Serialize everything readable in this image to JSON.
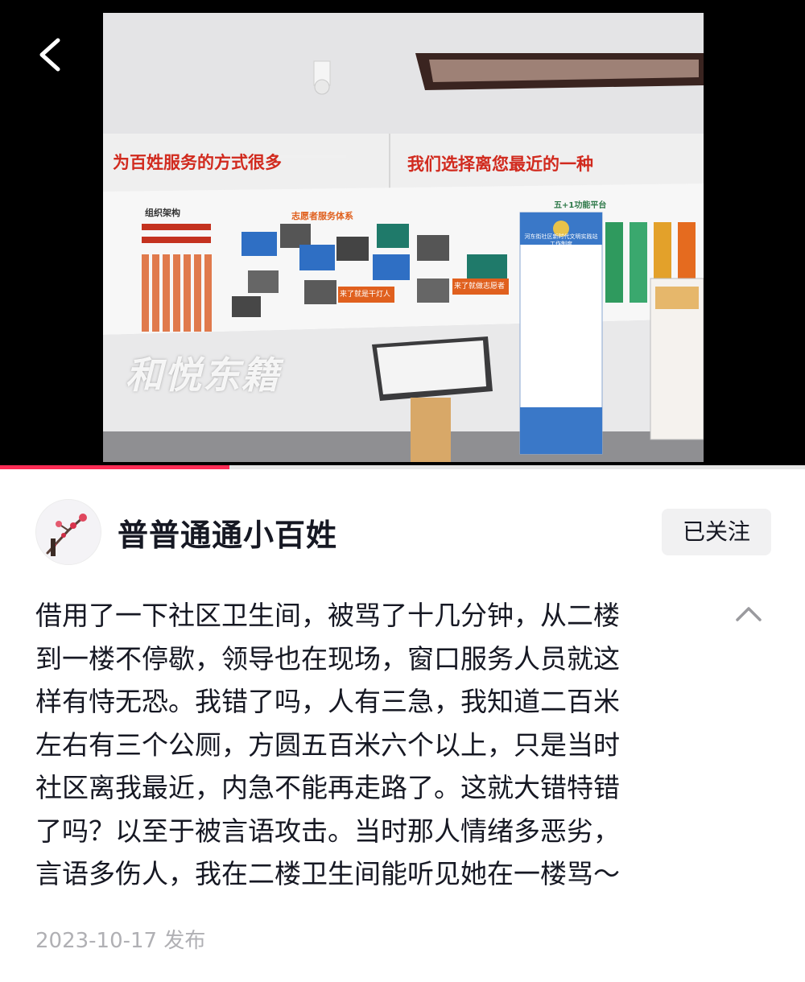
{
  "photo": {
    "banner_left": "为百姓服务的方式很多",
    "banner_right": "我们选择离您最近的一种",
    "org_title": "组织架构",
    "service_title": "志愿者服务体系",
    "platform_title": "五+1功能平台",
    "slogan_1": "来了就是干灯人",
    "slogan_2": "来了就做志愿者",
    "standee_title": "河东街社区新时代文明实践站工作制度",
    "watermark": "和悦东籍"
  },
  "progress": {
    "fraction": 0.285,
    "color": "#fe2c55"
  },
  "author": {
    "name": "普普通通小百姓",
    "avatar_icon": "plum-blossom-icon"
  },
  "follow": {
    "label": "已关注"
  },
  "post": {
    "lines": [
      "借用了一下社区卫生间，被骂了十几分钟，从二楼",
      "到一楼不停歇，领导也在现场，窗口服务人员就这",
      "样有恃无恐。我错了吗，人有三急，我知道二百米",
      "左右有三个公厕，方圆五百米六个以上，只是当时",
      "社区离我最近，内急不能再走路了。这就大错特错",
      "了吗？以至于被言语攻击。当时那人情绪多恶劣，",
      "言语多伤人，我在二楼卫生间能听见她在一楼骂～"
    ],
    "date": "2023-10-17 发布"
  },
  "icons": {
    "back": "back-chevron-icon",
    "collapse": "chevron-up-icon"
  }
}
